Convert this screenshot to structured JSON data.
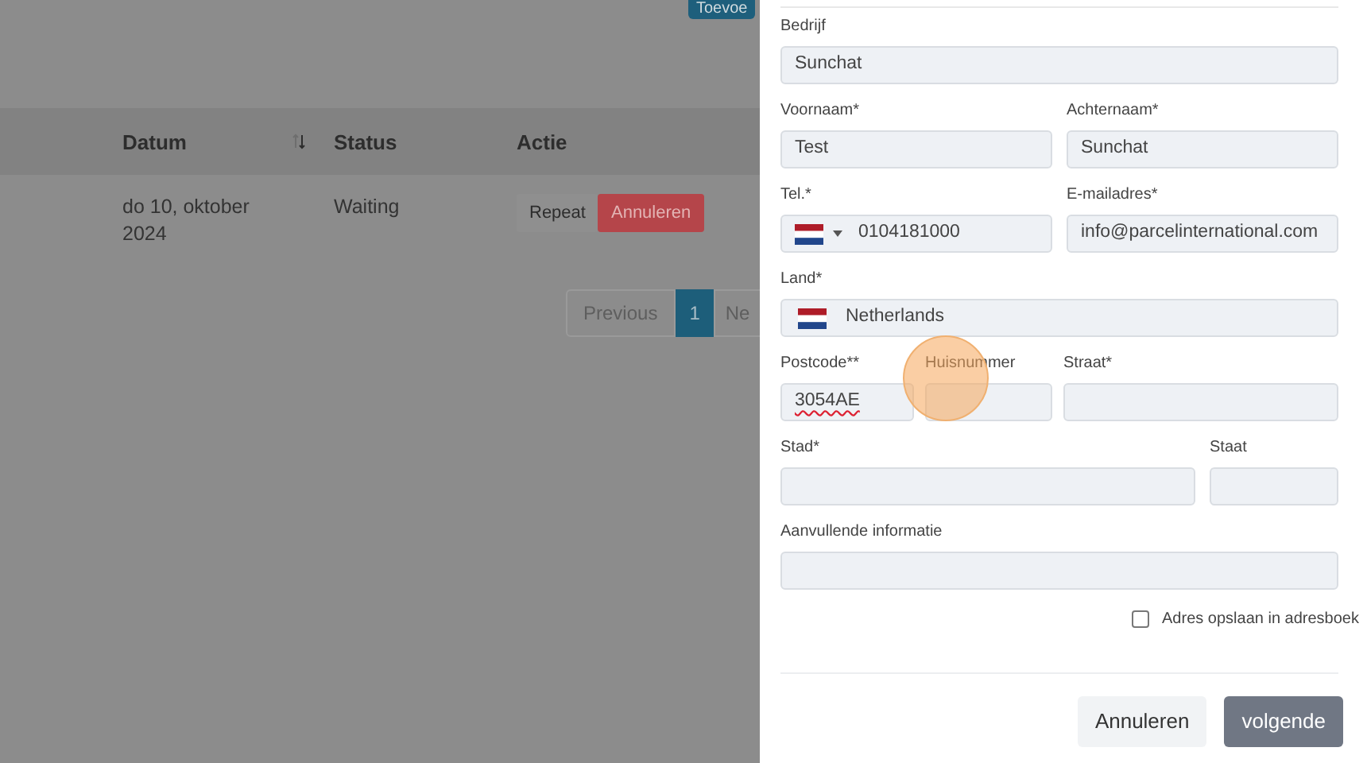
{
  "background_page": {
    "add_button": "Toevoe",
    "table": {
      "columns": [
        {
          "label": "Datum",
          "sort": true
        },
        {
          "label": "Status",
          "sort": false
        },
        {
          "label": "Actie",
          "sort": false
        }
      ],
      "rows": [
        {
          "datum": "do 10, oktober 2024",
          "status": "Waiting",
          "actions": [
            {
              "label": "Repeat",
              "kind": "secondary"
            },
            {
              "label": "Annuleren",
              "kind": "danger"
            }
          ]
        }
      ]
    },
    "pagination": [
      {
        "label": "Previous",
        "selected": false
      },
      {
        "label": "1",
        "selected": true
      },
      {
        "label": "Ne",
        "selected": false
      }
    ]
  },
  "form": {
    "rows": [
      {
        "kind": "single",
        "fields": [
          {
            "label": "Bedrijf",
            "value": "Sunchat",
            "kind": "text"
          }
        ]
      },
      {
        "kind": "pair",
        "fields": [
          {
            "label": "Voornaam*",
            "value": "Test",
            "kind": "text"
          },
          {
            "label": "Achternaam*",
            "value": "Sunchat",
            "kind": "text"
          }
        ]
      },
      {
        "kind": "pair",
        "fields": [
          {
            "label": "Tel.*",
            "value": "0104181000",
            "kind": "phone"
          },
          {
            "label": "E-mailadres*",
            "value": "info@parcelinternational.com",
            "kind": "text"
          }
        ]
      },
      {
        "kind": "single",
        "fields": [
          {
            "label": "Land*",
            "value": "Netherlands",
            "kind": "country"
          }
        ]
      },
      {
        "kind": "triple",
        "fields": [
          {
            "label": "Postcode**",
            "value": "3054AE",
            "kind": "text",
            "spelling_error": true
          },
          {
            "label": "Huisnummer",
            "kind": "text"
          },
          {
            "label": "Straat*",
            "kind": "text"
          }
        ]
      },
      {
        "kind": "wide-narrow",
        "fields": [
          {
            "label": "Stad*",
            "kind": "text"
          },
          {
            "label": "Staat",
            "kind": "text"
          }
        ]
      },
      {
        "kind": "single",
        "fields": [
          {
            "label": "Aanvullende informatie",
            "kind": "text"
          }
        ]
      }
    ],
    "save_checkbox": {
      "label": "Adres opslaan in adresboek",
      "checked": false
    },
    "buttons": [
      {
        "label": "Annuleren",
        "kind": "secondary"
      },
      {
        "label": "volgende",
        "kind": "primary"
      }
    ]
  }
}
